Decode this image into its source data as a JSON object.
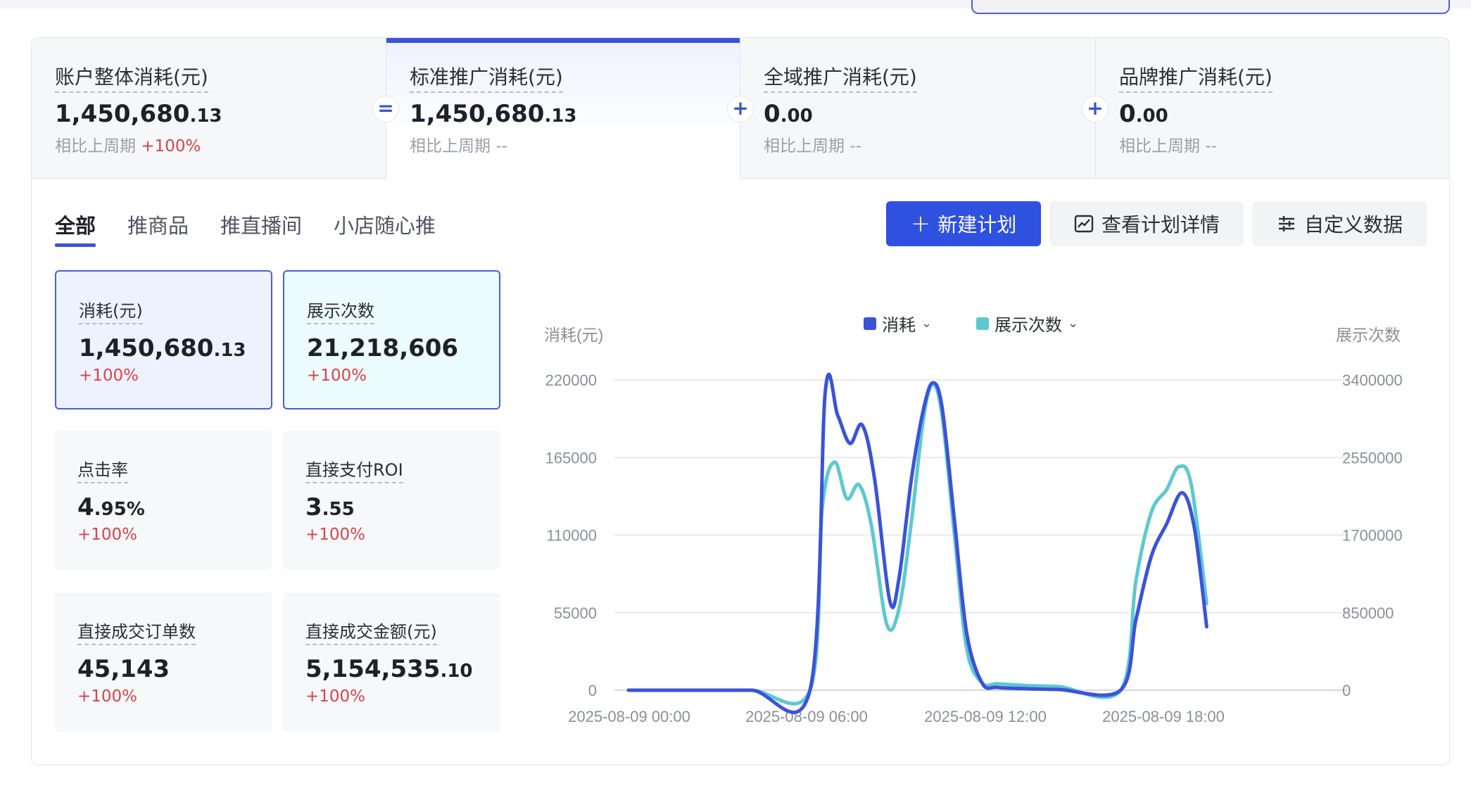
{
  "summary": [
    {
      "title": "账户整体消耗(元)",
      "value_int": "1,450,680",
      "value_frac": ".13",
      "cmp_label": "相比上周期",
      "cmp_value": "+100%"
    },
    {
      "title": "标准推广消耗(元)",
      "value_int": "1,450,680",
      "value_frac": ".13",
      "cmp_label": "相比上周期",
      "cmp_value": "--"
    },
    {
      "title": "全域推广消耗(元)",
      "value_int": "0",
      "value_frac": ".00",
      "cmp_label": "相比上周期",
      "cmp_value": "--"
    },
    {
      "title": "品牌推广消耗(元)",
      "value_int": "0",
      "value_frac": ".00",
      "cmp_label": "相比上周期",
      "cmp_value": "--"
    }
  ],
  "operators": [
    "=",
    "+",
    "+"
  ],
  "tabs": [
    "全部",
    "推商品",
    "推直播间",
    "小店随心推"
  ],
  "buttons": {
    "new_plan": "新建计划",
    "view_plan": "查看计划详情",
    "custom_data": "自定义数据"
  },
  "metrics": [
    {
      "title": "消耗(元)",
      "value_int": "1,450,680",
      "value_frac": ".13",
      "change": "+100%"
    },
    {
      "title": "展示次数",
      "value_int": "21,218,606",
      "value_frac": "",
      "change": "+100%"
    },
    {
      "title": "点击率",
      "value_int": "4",
      "value_frac": ".95%",
      "change": "+100%"
    },
    {
      "title": "直接支付ROI",
      "value_int": "3",
      "value_frac": ".55",
      "change": "+100%"
    },
    {
      "title": "直接成交订单数",
      "value_int": "45,143",
      "value_frac": "",
      "change": "+100%"
    },
    {
      "title": "直接成交金额(元)",
      "value_int": "5,154,535",
      "value_frac": ".10",
      "change": "+100%"
    }
  ],
  "chart_data": {
    "type": "line",
    "legend": [
      "消耗",
      "展示次数"
    ],
    "ylabel_left": "消耗(元)",
    "ylabel_right": "展示次数",
    "y_left_ticks": [
      "220000",
      "165000",
      "110000",
      "55000",
      "0"
    ],
    "y_right_ticks": [
      "3400000",
      "2550000",
      "1700000",
      "850000",
      "0"
    ],
    "x_ticks": [
      "2025-08-09 00:00",
      "2025-08-09 06:00",
      "2025-08-09 12:00",
      "2025-08-09 18:00"
    ],
    "ylim_left": [
      0,
      220000
    ],
    "ylim_right": [
      0,
      3400000
    ],
    "grid": true,
    "series": [
      {
        "name": "消耗",
        "axis": "left",
        "color": "#3b53d8",
        "points": [
          [
            0,
            0
          ],
          [
            2,
            0
          ],
          [
            4,
            0
          ],
          [
            5.9,
            0
          ],
          [
            6.4,
            212000
          ],
          [
            6.8,
            195000
          ],
          [
            7.2,
            175000
          ],
          [
            7.6,
            188000
          ],
          [
            8.0,
            150000
          ],
          [
            8.5,
            63000
          ],
          [
            8.8,
            80000
          ],
          [
            9.2,
            150000
          ],
          [
            9.6,
            200000
          ],
          [
            9.9,
            218000
          ],
          [
            10.2,
            200000
          ],
          [
            10.6,
            120000
          ],
          [
            11.0,
            40000
          ],
          [
            11.5,
            5000
          ],
          [
            12,
            2000
          ],
          [
            13,
            1000
          ],
          [
            14,
            500
          ],
          [
            16,
            0
          ],
          [
            16.5,
            50000
          ],
          [
            17,
            95000
          ],
          [
            17.5,
            118000
          ],
          [
            18,
            140000
          ],
          [
            18.4,
            115000
          ],
          [
            18.8,
            45000
          ]
        ]
      },
      {
        "name": "展示次数",
        "axis": "right",
        "color": "#5cc9d0",
        "points": [
          [
            0,
            0
          ],
          [
            2,
            0
          ],
          [
            4,
            0
          ],
          [
            5.9,
            0
          ],
          [
            6.3,
            2000000
          ],
          [
            6.7,
            2500000
          ],
          [
            7.1,
            2100000
          ],
          [
            7.5,
            2250000
          ],
          [
            7.9,
            1800000
          ],
          [
            8.4,
            720000
          ],
          [
            8.8,
            900000
          ],
          [
            9.2,
            1850000
          ],
          [
            9.6,
            3000000
          ],
          [
            9.9,
            3350000
          ],
          [
            10.2,
            3000000
          ],
          [
            10.6,
            1700000
          ],
          [
            11.0,
            450000
          ],
          [
            11.5,
            80000
          ],
          [
            12,
            70000
          ],
          [
            13,
            50000
          ],
          [
            14,
            40000
          ],
          [
            16,
            0
          ],
          [
            16.5,
            1200000
          ],
          [
            17,
            1950000
          ],
          [
            17.5,
            2200000
          ],
          [
            17.9,
            2450000
          ],
          [
            18.3,
            2250000
          ],
          [
            18.8,
            950000
          ]
        ]
      }
    ]
  }
}
